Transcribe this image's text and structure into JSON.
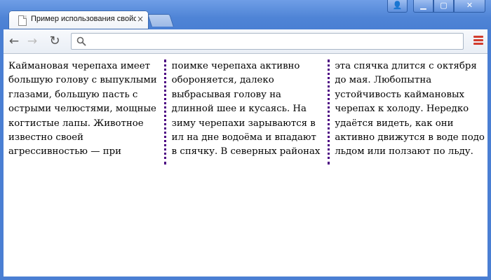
{
  "window": {
    "tab_title": "Пример использования свойства column-rule",
    "tab_close": "×",
    "buttons": {
      "user": "👤",
      "min": "▁",
      "max": "▢",
      "close": "✕"
    },
    "accent": "#4a7fd3"
  },
  "toolbar": {
    "back_icon": "←",
    "forward_icon": "→",
    "reload_icon": "↻",
    "address": "",
    "menu_color": "#d23c2e"
  },
  "content": {
    "text": "Каймановая черепаха имеет большую голову с выпуклыми глазами, большую пасть с острыми челюстями, мощные когтистые лапы. Животное известно своей агрессивностью — при поимке черепаха активно обороняется, далеко выбрасывая голову на длинной шее и кусаясь. На зиму черепахи зарываются в ил на дне водоёма и впадают в спячку. В северных районах эта спячка длится с октября до мая. Любопытна устойчивость каймановых черепах к холоду. Нередко удаётся видеть, как они активно движутся в воде подо льдом или ползают по льду.",
    "column_rule_color": "#4b0082"
  }
}
